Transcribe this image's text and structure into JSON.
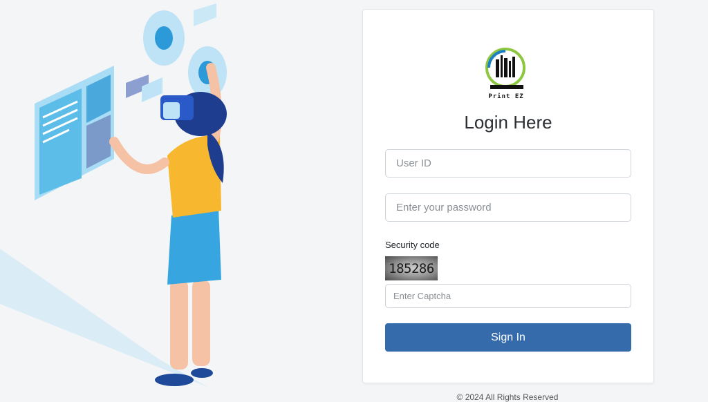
{
  "brand": {
    "name": "Print EZ"
  },
  "login": {
    "title": "Login Here",
    "user_id_placeholder": "User ID",
    "password_placeholder": "Enter your password",
    "security_label": "Security code",
    "captcha_code": "185286",
    "captcha_placeholder": "Enter Captcha",
    "signin_label": "Sign In"
  },
  "footer": {
    "text": "© 2024 All Rights Reserved"
  },
  "colors": {
    "primary_button": "#356bab",
    "background": "#f4f5f7",
    "illustration_blue": "#3ea8dc"
  }
}
